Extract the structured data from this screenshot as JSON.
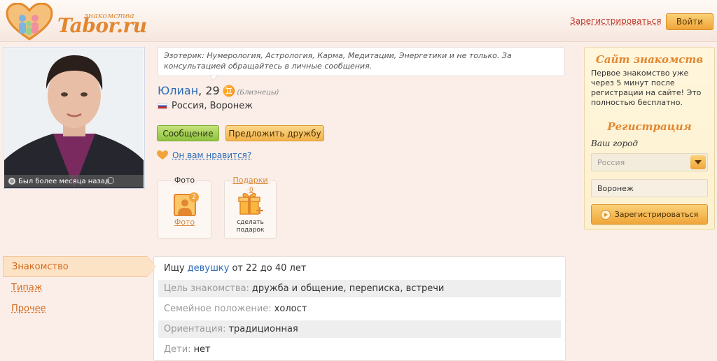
{
  "header": {
    "logo_small": "знакомства",
    "logo_text": "Tabor.ru",
    "register_link": "Зарегистрироваться",
    "login_button": "Войти"
  },
  "profile": {
    "photo_status": "Был более месяца назад",
    "description": "Эзотерик: Нумерология, Астрология, Карма, Медитации, Энергетики и не только. За консультацией обращайтесь в личные сообщения.",
    "name": "Юлиан",
    "age": ", 29",
    "zodiac_symbol": "♊",
    "zodiac_name": "(Близнецы)",
    "location": "Россия, Воронеж",
    "message_button": "Сообщение",
    "friend_button": "Предложить дружбу",
    "like_link": "Он вам нравится?",
    "tiles": {
      "photo_title": "Фото",
      "photo_count": "2",
      "photo_link": "Фото",
      "gifts_title": "Подарки",
      "gifts_count": "0",
      "gift_label_1": "сделать",
      "gift_label_2": "подарок"
    }
  },
  "sidebar": {
    "title": "Сайт знакомств",
    "text": "Первое знакомство уже через 5 минут после регистрации на сайте! Это полностью бесплатно.",
    "registration_title": "Регистрация",
    "city_label": "Ваш город",
    "country_select": "Россия",
    "city_input": "Воронеж",
    "register_button": "Зарегистрироваться"
  },
  "nav": {
    "items": [
      "Знакомство",
      "Типаж",
      "Прочее"
    ]
  },
  "info": {
    "seeking_prefix": "Ищу",
    "seeking_link": "девушку",
    "seeking_suffix": "от 22 до 40 лет",
    "goal_key": "Цель знакомства:",
    "goal_val": "дружба и общение, переписка, встречи",
    "family_key": "Семейное положение:",
    "family_val": "холост",
    "orientation_key": "Ориентация:",
    "orientation_val": "традиционная",
    "kids_key": "Дети:",
    "kids_val": "нет"
  },
  "colors": {
    "accent": "#e2862f",
    "link": "#2a6ab5",
    "background": "#fbeee8"
  },
  "icons": [
    "logo-heart-icon",
    "status-dot-icon",
    "zoom-icon",
    "flag-ru-icon",
    "heart-icon",
    "photo-icon",
    "gift-icon",
    "arrow-down-icon",
    "play-circle-icon"
  ]
}
